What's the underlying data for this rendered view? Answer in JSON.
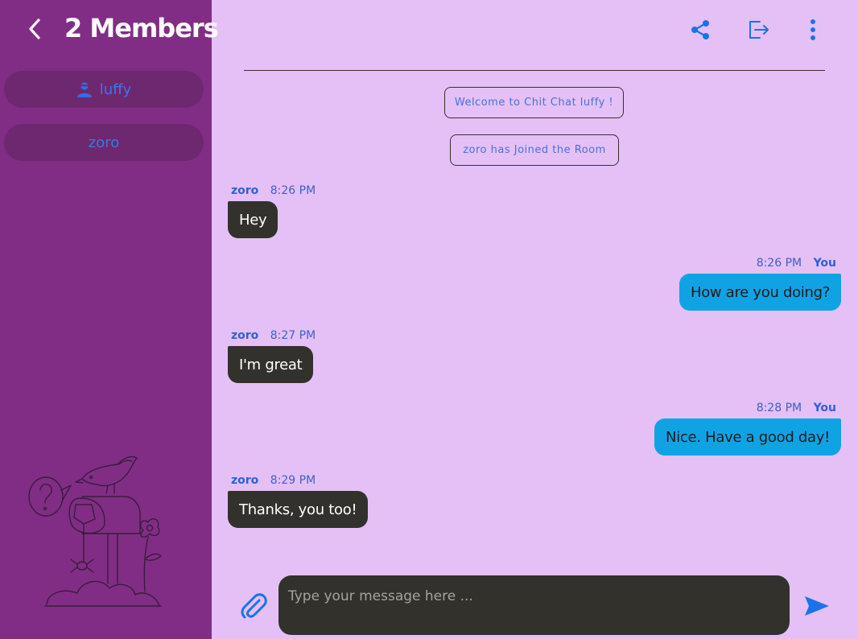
{
  "sidebar": {
    "title": "2 Members",
    "members": [
      {
        "name": "luffy",
        "icon": "user-icon"
      },
      {
        "name": "zoro"
      }
    ]
  },
  "header": {
    "icons": [
      "share-icon",
      "leave-room-icon",
      "more-vertical-icon"
    ]
  },
  "notices": [
    "Welcome to Chit Chat luffy !",
    "zoro has Joined the Room"
  ],
  "messages": [
    {
      "sender": "zoro",
      "time": "8:26 PM",
      "text": "Hey",
      "direction": "in"
    },
    {
      "sender": "You",
      "time": "8:26 PM",
      "text": "How are you doing?",
      "direction": "out"
    },
    {
      "sender": "zoro",
      "time": "8:27 PM",
      "text": "I'm great",
      "direction": "in"
    },
    {
      "sender": "You",
      "time": "8:28 PM",
      "text": "Nice. Have a good day!",
      "direction": "out"
    },
    {
      "sender": "zoro",
      "time": "8:29 PM",
      "text": "Thanks, you too!",
      "direction": "in"
    }
  ],
  "composer": {
    "placeholder": "Type your message here ...",
    "value": ""
  },
  "colors": {
    "sidebar_bg": "#812d85",
    "main_bg": "#e4c0f7",
    "accent": "#1a73e8",
    "incoming_bubble": "#32312c",
    "outgoing_bubble": "#10a3e4"
  }
}
